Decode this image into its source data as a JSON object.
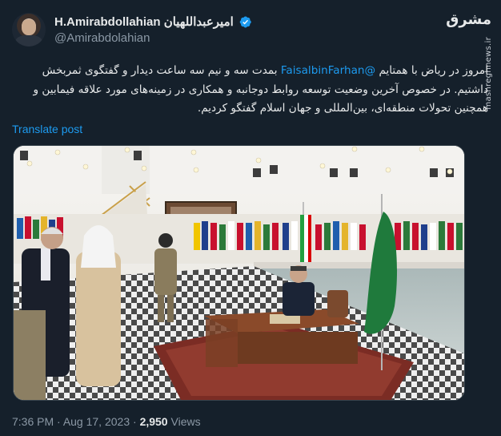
{
  "author": {
    "display_name": "H.Amirabdollahian امیرعبداللهیان",
    "handle": "@Amirabdolahian",
    "verified_icon": "verified-badge-icon",
    "accent": "#1d9bf0"
  },
  "watermark": {
    "logo": "مشرق",
    "site": "mashreghnews.ir"
  },
  "tweet": {
    "text_before_mention": "امروز در ریاض با همتایم ",
    "mention": "@FaisalbinFarhan",
    "text_after_mention": " بمدت سه و نیم سه ساعت دیدار و گفتگوی ثمربخش داشتیم. در خصوص آخرین وضعیت توسعه روابط دوجانبه و همکاری در زمینه‌های مورد علاقه فیمابین و همچنین تحولات منطقه‌ای، بین‌المللی و جهان اسلام گفتگو کردیم.",
    "translate_label": "Translate post"
  },
  "meta": {
    "time": "7:36 PM",
    "separator": " · ",
    "date": "Aug 17, 2023",
    "views_count": "2,950",
    "views_label": " Views"
  }
}
